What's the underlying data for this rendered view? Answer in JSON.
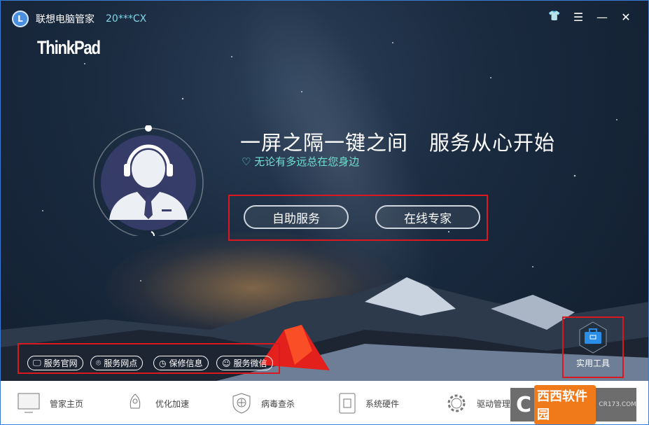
{
  "app": {
    "title": "联想电脑管家",
    "model": "20***CX",
    "brand_logo": "ThinkPad",
    "logo_letter": "L"
  },
  "window_controls": [
    {
      "icon": "skin-icon",
      "glyph": "👕"
    },
    {
      "icon": "menu-icon",
      "glyph": "☰"
    },
    {
      "icon": "minimize-icon",
      "glyph": "—"
    },
    {
      "icon": "close-icon",
      "glyph": "✕"
    }
  ],
  "hero": {
    "headline": "一屏之隔一键之间　服务从心开始",
    "subtitle": "无论有多远总在您身边",
    "subtitle_icon": "heart-icon"
  },
  "buttons": {
    "self_service": "自助服务",
    "online_expert": "在线专家"
  },
  "service_links": [
    {
      "label": "服务官网",
      "icon": "monitor-icon",
      "glyph": "🖵"
    },
    {
      "label": "服务网点",
      "icon": "location-icon",
      "glyph": "⌾"
    },
    {
      "label": "保修信息",
      "icon": "clock-icon",
      "glyph": "◷"
    },
    {
      "label": "服务微信",
      "icon": "chat-icon",
      "glyph": "☺"
    }
  ],
  "tools": {
    "label": "实用工具",
    "icon": "toolbox-icon"
  },
  "bottom_nav": [
    {
      "label": "管家主页",
      "icon": "monitor-icon"
    },
    {
      "label": "优化加速",
      "icon": "rocket-icon"
    },
    {
      "label": "病毒查杀",
      "icon": "shield-icon"
    },
    {
      "label": "系统硬件",
      "icon": "chip-icon"
    },
    {
      "label": "驱动管理",
      "icon": "gear-icon"
    }
  ],
  "watermark": {
    "text": "西西软件园",
    "url": "CR173.COM"
  },
  "colors": {
    "accent_cyan": "#6fe0d0",
    "highlight_red": "#d9191f",
    "title_blue": "#3a7bd5"
  }
}
